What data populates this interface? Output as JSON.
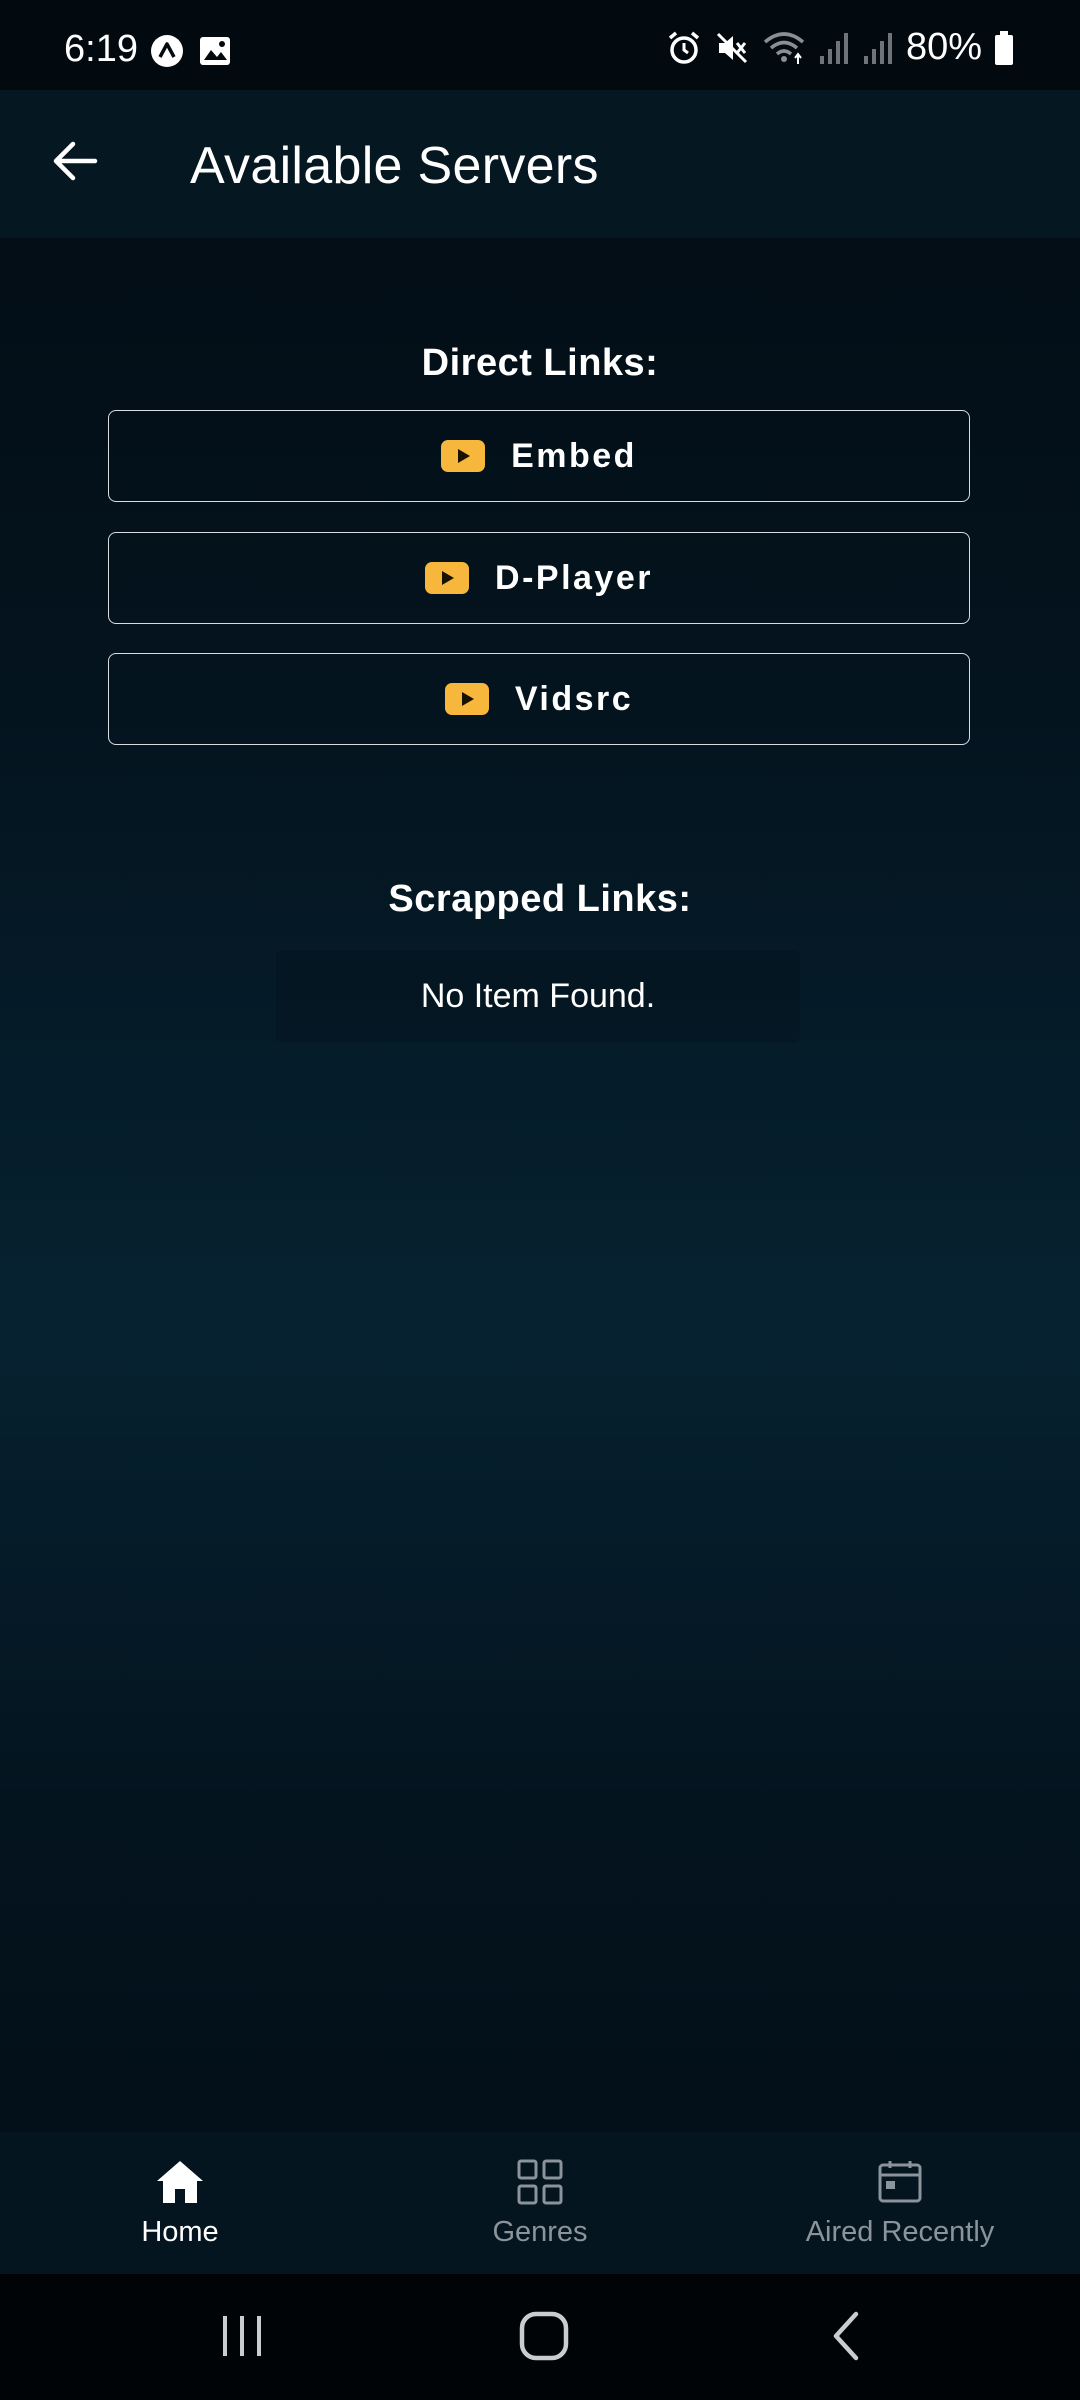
{
  "status_bar": {
    "time": "6:19",
    "battery": "80%"
  },
  "header": {
    "title": "Available Servers"
  },
  "direct_links": {
    "heading": "Direct Links:",
    "servers": [
      {
        "label": "Embed"
      },
      {
        "label": "D-Player"
      },
      {
        "label": "Vidsrc"
      }
    ]
  },
  "scrapped_links": {
    "heading": "Scrapped Links:",
    "empty_text": "No Item Found."
  },
  "bottom_nav": {
    "items": [
      {
        "label": "Home",
        "icon": "home-icon",
        "active": true
      },
      {
        "label": "Genres",
        "icon": "grid-icon",
        "active": false
      },
      {
        "label": "Aired Recently",
        "icon": "calendar-icon",
        "active": false
      }
    ]
  },
  "colors": {
    "accent_icon": "#f6b73c",
    "background": "#04141f"
  }
}
